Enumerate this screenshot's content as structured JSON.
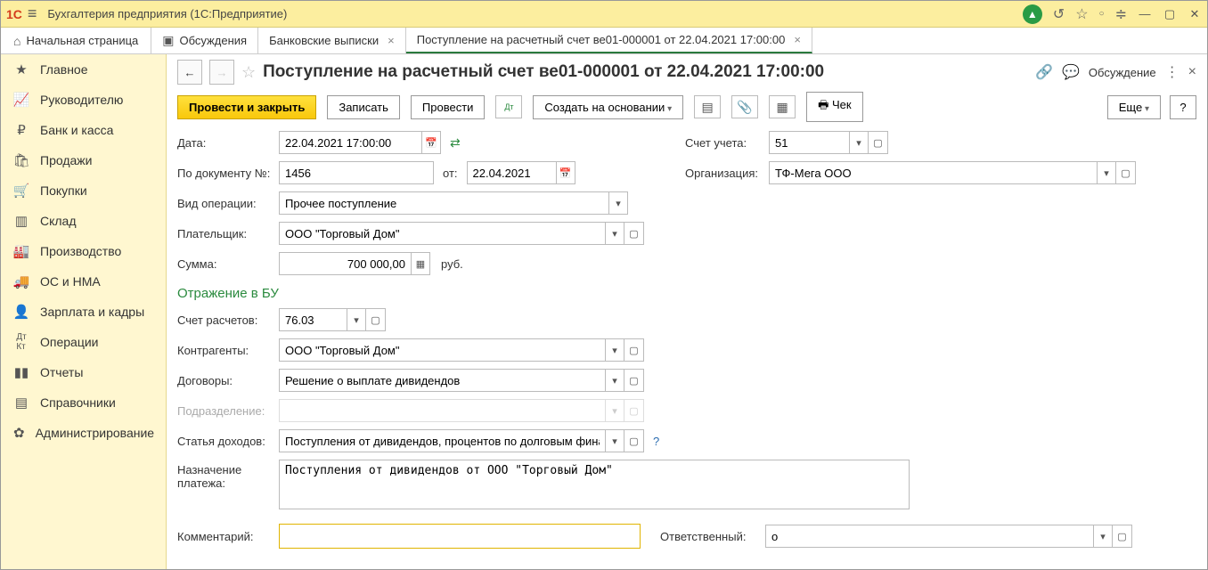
{
  "titlebar": {
    "app_title": "Бухгалтерия предприятия  (1С:Предприятие)"
  },
  "tabs": {
    "home": "Начальная страница",
    "t1": "Обсуждения",
    "t2": "Банковские выписки",
    "t3": "Поступление на расчетный счет ве01-000001 от 22.04.2021 17:00:00"
  },
  "sidebar": {
    "items": [
      {
        "label": "Главное"
      },
      {
        "label": "Руководителю"
      },
      {
        "label": "Банк и касса"
      },
      {
        "label": "Продажи"
      },
      {
        "label": "Покупки"
      },
      {
        "label": "Склад"
      },
      {
        "label": "Производство"
      },
      {
        "label": "ОС и НМА"
      },
      {
        "label": "Зарплата и кадры"
      },
      {
        "label": "Операции"
      },
      {
        "label": "Отчеты"
      },
      {
        "label": "Справочники"
      },
      {
        "label": "Администрирование"
      }
    ]
  },
  "doc": {
    "title": "Поступление на расчетный счет ве01-000001 от 22.04.2021 17:00:00",
    "discussion": "Обсуждение"
  },
  "toolbar": {
    "post_close": "Провести и закрыть",
    "save": "Записать",
    "post": "Провести",
    "create_based": "Создать на основании",
    "cheque": "Чек",
    "more": "Еще"
  },
  "form": {
    "date_label": "Дата:",
    "date_value": "22.04.2021 17:00:00",
    "docnum_label": "По документу №:",
    "docnum_value": "1456",
    "docnum_from": "от:",
    "docnum_date": "22.04.2021",
    "account_label": "Счет учета:",
    "account_value": "51",
    "org_label": "Организация:",
    "org_value": "ТФ-Мега ООО",
    "optype_label": "Вид операции:",
    "optype_value": "Прочее поступление",
    "payer_label": "Плательщик:",
    "payer_value": "ООО \"Торговый Дом\"",
    "sum_label": "Сумма:",
    "sum_value": "700 000,00",
    "sum_currency": "руб.",
    "section_bu": "Отражение в БУ",
    "settle_acct_label": "Счет расчетов:",
    "settle_acct_value": "76.03",
    "counterparty_label": "Контрагенты:",
    "counterparty_value": "ООО \"Торговый Дом\"",
    "contract_label": "Договоры:",
    "contract_value": "Решение о выплате дивидендов",
    "subdiv_label": "Подразделение:",
    "income_label": "Статья доходов:",
    "income_value": "Поступления от дивидендов, процентов по долговым финан",
    "purpose_label": "Назначение платежа:",
    "purpose_value": "Поступления от дивидендов от ООО \"Торговый Дом\"",
    "comment_label": "Комментарий:",
    "comment_value": "",
    "responsible_label": "Ответственный:",
    "responsible_value": "о"
  }
}
